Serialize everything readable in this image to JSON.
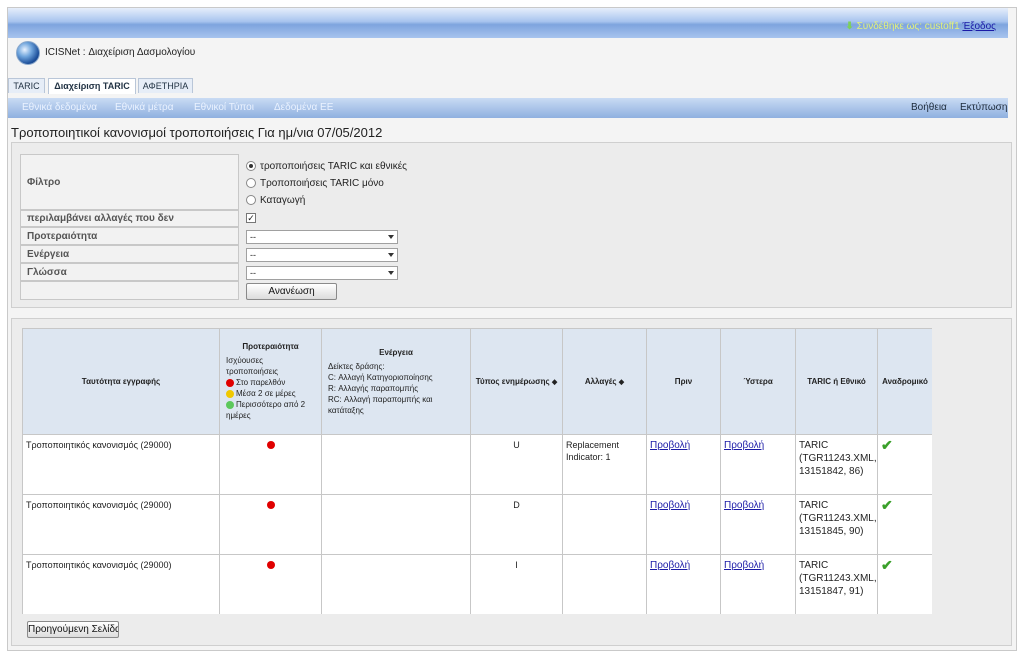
{
  "header": {
    "user_prefix": "Συνδέθηκε ως: custoff1",
    "logout": "Έξοδος",
    "app_title": "ICISNet : Διαχείριση Δασμολογίου"
  },
  "tabs": [
    {
      "label": "TARIC"
    },
    {
      "label": "Διαχείριση TARIC"
    },
    {
      "label": "ΑΦΕΤΗΡΙΑ"
    }
  ],
  "nav": {
    "left": [
      "Εθνικά δεδομένα",
      "Εθνικά μέτρα",
      "Εθνικοί Τύποι",
      "Δεδομένα ΕΕ"
    ],
    "help": "Βοήθεια",
    "print": "Εκτύπωση"
  },
  "page_title": "Τροποποιητικοί κανονισμοί τροποποιήσεις Για ημ/νια 07/05/2012",
  "filters": {
    "filter_label": "Φίλτρο",
    "radio_options": [
      "τροποποιήσεις TARIC και εθνικές",
      "Τροποποιήσεις TARIC μόνο",
      "Καταγωγή"
    ],
    "selected_radio": 0,
    "include_label": "περιλαμβάνει αλλαγές που δεν ενσωματώθηκαν",
    "include_checked": true,
    "priority_label": "Προτεραιότητα",
    "priority_value": "--",
    "action_label": "Ενέργεια",
    "action_value": "--",
    "language_label": "Γλώσσα",
    "language_value": "--",
    "refresh_button": "Ανανέωση"
  },
  "table": {
    "headers": {
      "id": "Ταυτότητα εγγραφής",
      "priority": "Προτεραιότητα",
      "priority_sub": "Ισχύουσες τροποποιήσεις",
      "priority_red": "Στο παρελθόν",
      "priority_yellow": "Μέσα 2 σε μέρες",
      "priority_green": "Περισσότερο από 2 ημέρες",
      "action": "Ενέργεια",
      "action_sub": "Δείκτες δράσης:",
      "action_c": "C: Αλλαγή Κατηγοριοποίησης",
      "action_r": "R: Αλλαγής παραπομπής",
      "action_rc": "RC: Αλλαγή παραπομπής και κατάταξης",
      "update_type": "Τύπος ενημέρωσης",
      "changes": "Αλλαγές",
      "before": "Πριν",
      "after": "Ύστερα",
      "taric_nat": "TARIC ή Εθνικό",
      "retro": "Αναδρομικό"
    },
    "rows": [
      {
        "id": "Τροποποιητικός κανονισμός (29000)",
        "update_type": "U",
        "changes": "Replacement Indicator: 1",
        "before": "Προβολή",
        "after": "Προβολή",
        "taric": "TARIC (TGR11243.XML, 13151842, 86)"
      },
      {
        "id": "Τροποποιητικός κανονισμός (29000)",
        "update_type": "D",
        "changes": "",
        "before": "Προβολή",
        "after": "Προβολή",
        "taric": "TARIC (TGR11243.XML, 13151845, 90)"
      },
      {
        "id": "Τροποποιητικός κανονισμός (29000)",
        "update_type": "I",
        "changes": "",
        "before": "Προβολή",
        "after": "Προβολή",
        "taric": "TARIC (TGR11243.XML, 13151847, 91)"
      }
    ]
  },
  "prev_button": "Προηγούμενη Σελίδα",
  "colors": {
    "priority_red": "#e00000",
    "priority_yellow": "#f0c800",
    "priority_green": "#5cc85c"
  }
}
